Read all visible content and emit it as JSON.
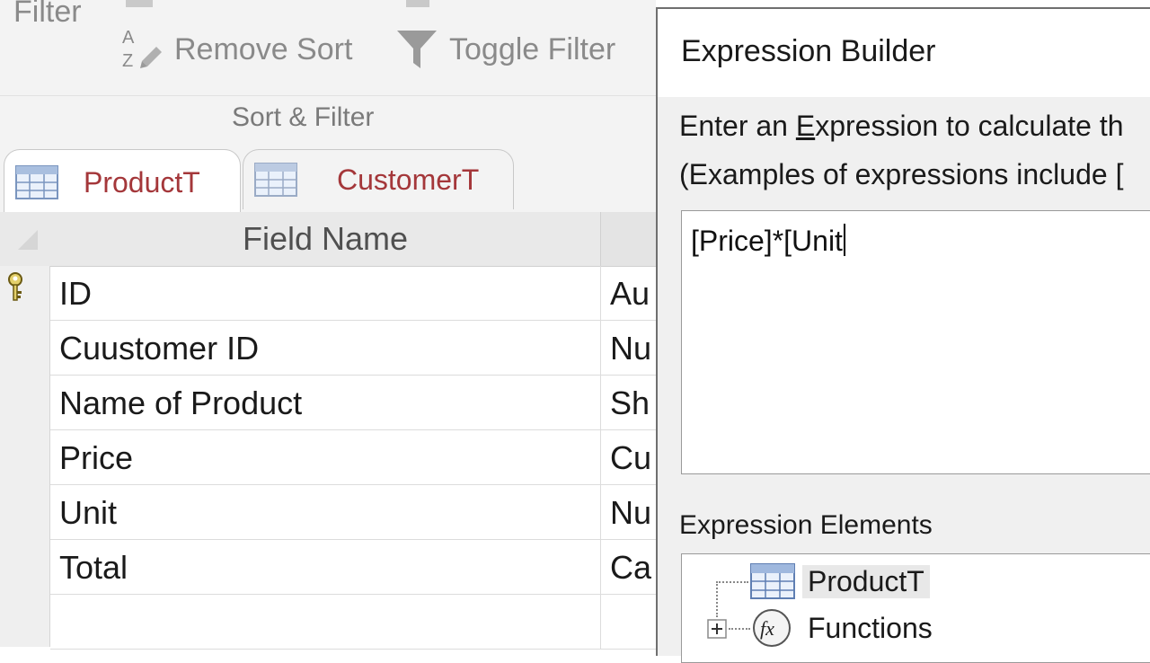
{
  "ribbon": {
    "filter_label": "Filter",
    "remove_sort_label": "Remove Sort",
    "toggle_filter_label": "Toggle Filter",
    "group_label": "Sort & Filter",
    "sort_icon": "sort-az-clear-icon",
    "filter_icon": "funnel-icon"
  },
  "tabs": [
    {
      "label": "ProductT",
      "icon": "table-icon",
      "active": true
    },
    {
      "label": "CustomerT",
      "icon": "table-icon",
      "active": false
    }
  ],
  "grid": {
    "header_field_name": "Field Name",
    "rows": [
      {
        "field": "ID",
        "type": "Au",
        "primary_key": true
      },
      {
        "field": "Cuustomer ID",
        "type": "Nu"
      },
      {
        "field": "Name of Product",
        "type": "Sh"
      },
      {
        "field": "Price",
        "type": "Cu"
      },
      {
        "field": "Unit",
        "type": "Nu"
      },
      {
        "field": "Total",
        "type": "Ca"
      },
      {
        "field": "",
        "type": ""
      }
    ]
  },
  "dialog": {
    "title": "Expression Builder",
    "instruction_pre": "Enter an ",
    "instruction_ul": "E",
    "instruction_post": "xpression to calculate th",
    "examples_text": "(Examples of expressions include [",
    "expression_value": "[Price]*[Unit",
    "elements_label": "Expression Elements",
    "tree": [
      {
        "label": "ProductT",
        "icon": "table-icon",
        "selected": true
      },
      {
        "label": "Functions",
        "icon": "fx-icon",
        "expandable": true
      }
    ]
  },
  "colors": {
    "tab_text": "#a4373a",
    "ribbon_bg": "#f3f3f3",
    "dialog_bg": "#f0f0f0"
  }
}
